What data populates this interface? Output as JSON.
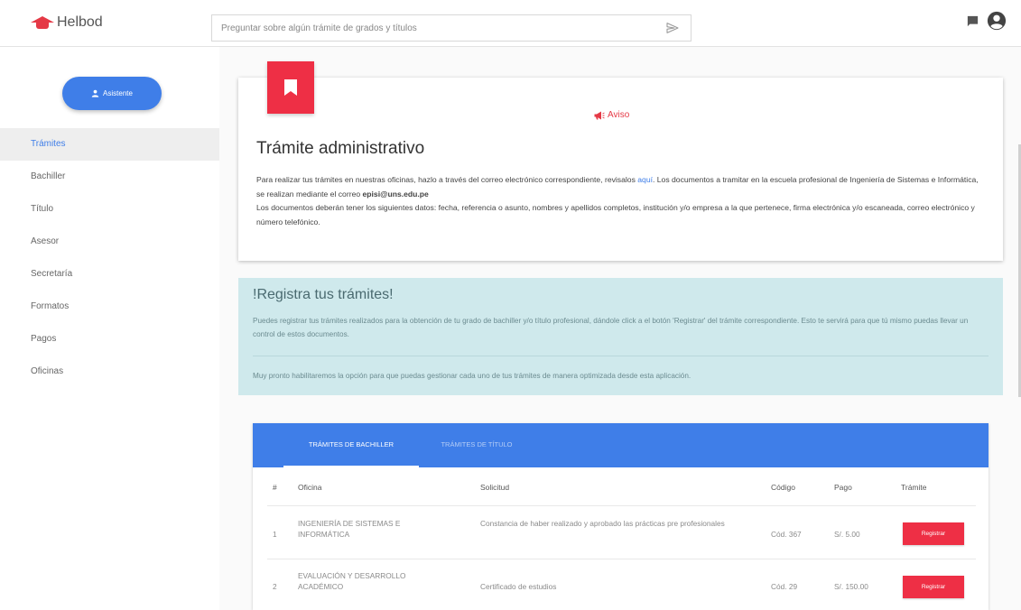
{
  "app": {
    "logo_text": "Helbod",
    "search_placeholder": "Preguntar sobre algún trámite de grados y títulos"
  },
  "sidebar": {
    "assistant_label": "Asistente",
    "items": [
      {
        "label": "Trámites",
        "active": true
      },
      {
        "label": "Bachiller"
      },
      {
        "label": "Título"
      },
      {
        "label": "Asesor"
      },
      {
        "label": "Secretaría"
      },
      {
        "label": "Formatos"
      },
      {
        "label": "Pagos"
      },
      {
        "label": "Oficinas"
      }
    ]
  },
  "notice": {
    "aviso": "Aviso",
    "title": "Trámite administrativo",
    "line1_a": "Para realizar tus trámites en nuestras oficinas, hazlo a través del correo electrónico correspondiente, revisalos ",
    "line1_link": "aquí",
    "line1_b": ". Los documentos a tramitar en la escuela profesional de Ingeniería de Sistemas e Informática, se realizan mediante el correo ",
    "email": "episi@uns.edu.pe",
    "line2": "Los documentos deberán tener los siguientes datos: fecha, referencia o asunto, nombres y apellidos completos, institución y/o empresa a la que pertenece, firma electrónica y/o escaneada, correo electrónico y número telefónico."
  },
  "register": {
    "title": "!Registra tus trámites!",
    "text": "Puedes registrar tus trámites realizados para la obtención de tu grado de bachiller y/o título profesional, dándole click a el botón 'Registrar' del trámite correspondiente. Esto te servirá para que tú mismo puedas llevar un control de estos documentos.",
    "soon": "Muy pronto habilitaremos la opción para que puedas gestionar cada uno de tus trámites de manera optimizada desde esta aplicación."
  },
  "procedures": {
    "tabs": [
      "TRÁMITES DE BACHILLER",
      "TRÁMITES DE TÍTULO"
    ],
    "headers": {
      "num": "#",
      "office": "Oficina",
      "request": "Solicitud",
      "code": "Código",
      "payment": "Pago",
      "action": "Trámite"
    },
    "rows": [
      {
        "num": "1",
        "office": "INGENIERÍA DE SISTEMAS E INFORMÁTICA",
        "request": "Constancia de haber realizado y aprobado las prácticas pre profesionales",
        "code": "Cód. 367",
        "payment": "S/. 5.00",
        "button": "Registrar"
      },
      {
        "num": "2",
        "office": "EVALUACIÓN Y DESARROLLO ACADÉMICO",
        "request": "Certificado de estudios",
        "code": "Cód. 29",
        "payment": "S/. 150.00",
        "button": "Registrar"
      }
    ]
  },
  "colors": {
    "primary": "#3f7ee8",
    "accent": "#ee2f45",
    "info_bg": "#cfe9ec"
  },
  "icons": {
    "logo": "graduation-cap-icon",
    "send": "send-icon",
    "chat": "chat-icon",
    "account": "account-circle-icon",
    "bookmark": "bookmark-icon",
    "aviso": "megaphone-icon",
    "user": "user-icon"
  }
}
